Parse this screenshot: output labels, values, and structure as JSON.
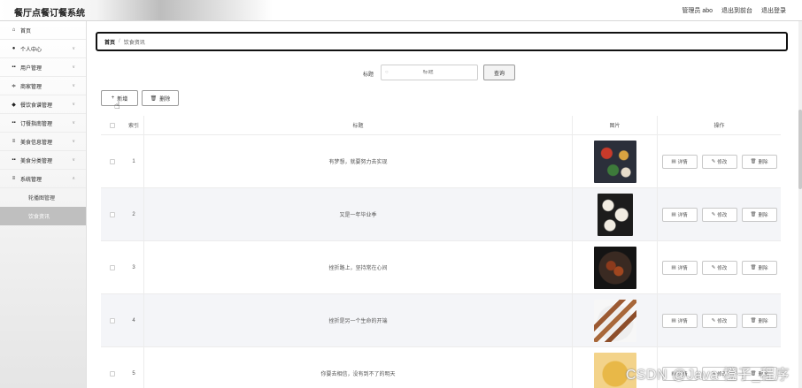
{
  "app": {
    "title": "餐厅点餐订餐系统",
    "admin_label": "管理员 abo",
    "to_front_label": "退出到前台",
    "logout_label": "退出登录"
  },
  "sidebar": {
    "items": [
      {
        "icon": "home-icon",
        "label": "首页"
      },
      {
        "icon": "user-icon",
        "label": "个人中心"
      },
      {
        "icon": "grid-icon",
        "label": "用户管理"
      },
      {
        "icon": "sliders-icon",
        "label": "商家管理"
      },
      {
        "icon": "tag-icon",
        "label": "餐饮食谱管理"
      },
      {
        "icon": "grid-icon",
        "label": "订餐指南管理"
      },
      {
        "icon": "list-icon",
        "label": "美食信息管理"
      },
      {
        "icon": "grid-icon",
        "label": "美食分类管理"
      },
      {
        "icon": "list-icon",
        "label": "系统管理"
      }
    ],
    "sub_items": [
      {
        "label": "轮播图管理",
        "active": false
      },
      {
        "label": "饮食资讯",
        "active": true
      }
    ]
  },
  "breadcrumb": {
    "home": "首页",
    "separator": "/",
    "current": "饮食资讯"
  },
  "search": {
    "label": "标题",
    "placeholder": "标题",
    "button": "查询"
  },
  "toolbar": {
    "add_label": "新增",
    "delete_label": "删除"
  },
  "table": {
    "headers": {
      "index": "索引",
      "title": "标题",
      "image": "图片",
      "actions": "操作"
    },
    "actions": {
      "detail": "详情",
      "edit": "修改",
      "delete": "删除"
    },
    "rows": [
      {
        "index": "1",
        "title": "有梦想，就要努力去实现"
      },
      {
        "index": "2",
        "title": "又是一年毕业季"
      },
      {
        "index": "3",
        "title": "挫折路上，坚持常在心间"
      },
      {
        "index": "4",
        "title": "挫折是另一个生命的开端"
      },
      {
        "index": "5",
        "title": "你要去相信，没有到不了的明天"
      }
    ]
  },
  "watermark": "CSDN @Java 橙子_程序"
}
